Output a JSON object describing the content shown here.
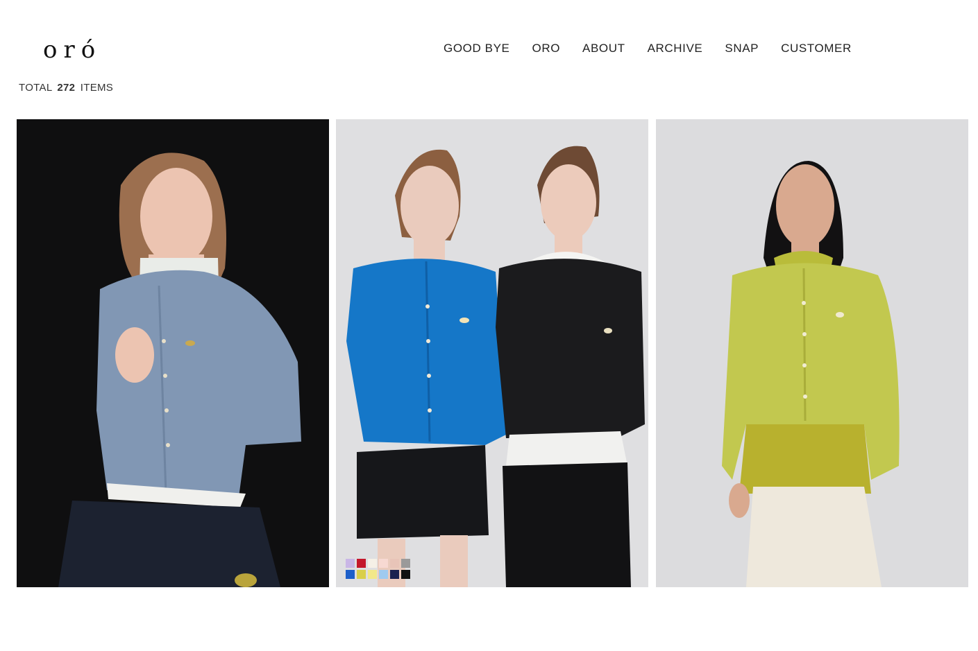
{
  "brand": {
    "logo_text": "oró"
  },
  "nav": {
    "items": [
      "GOOD BYE",
      "ORO",
      "ABOUT",
      "ARCHIVE",
      "SNAP",
      "CUSTOMER"
    ]
  },
  "listing": {
    "total_prefix": "TOTAL",
    "total_count": "272",
    "total_suffix": "ITEMS"
  },
  "products": [
    {
      "image": "model-blue-grey-cardigan-black-backdrop"
    },
    {
      "image": "two-models-blue-and-black-cardigans",
      "color_swatches": [
        "#c9b6e6",
        "#c4172b",
        "#f5f0e6",
        "#f7d9d2",
        "#e8c4b8",
        "#9a9a9a",
        "#1d5fc9",
        "#d9cf4a",
        "#f2e88a",
        "#9fcaef",
        "#1a2250",
        "#111111"
      ]
    },
    {
      "image": "model-lime-cardigan-grey-backdrop"
    }
  ],
  "colors": {
    "background": "#ffffff",
    "text": "#222222"
  }
}
